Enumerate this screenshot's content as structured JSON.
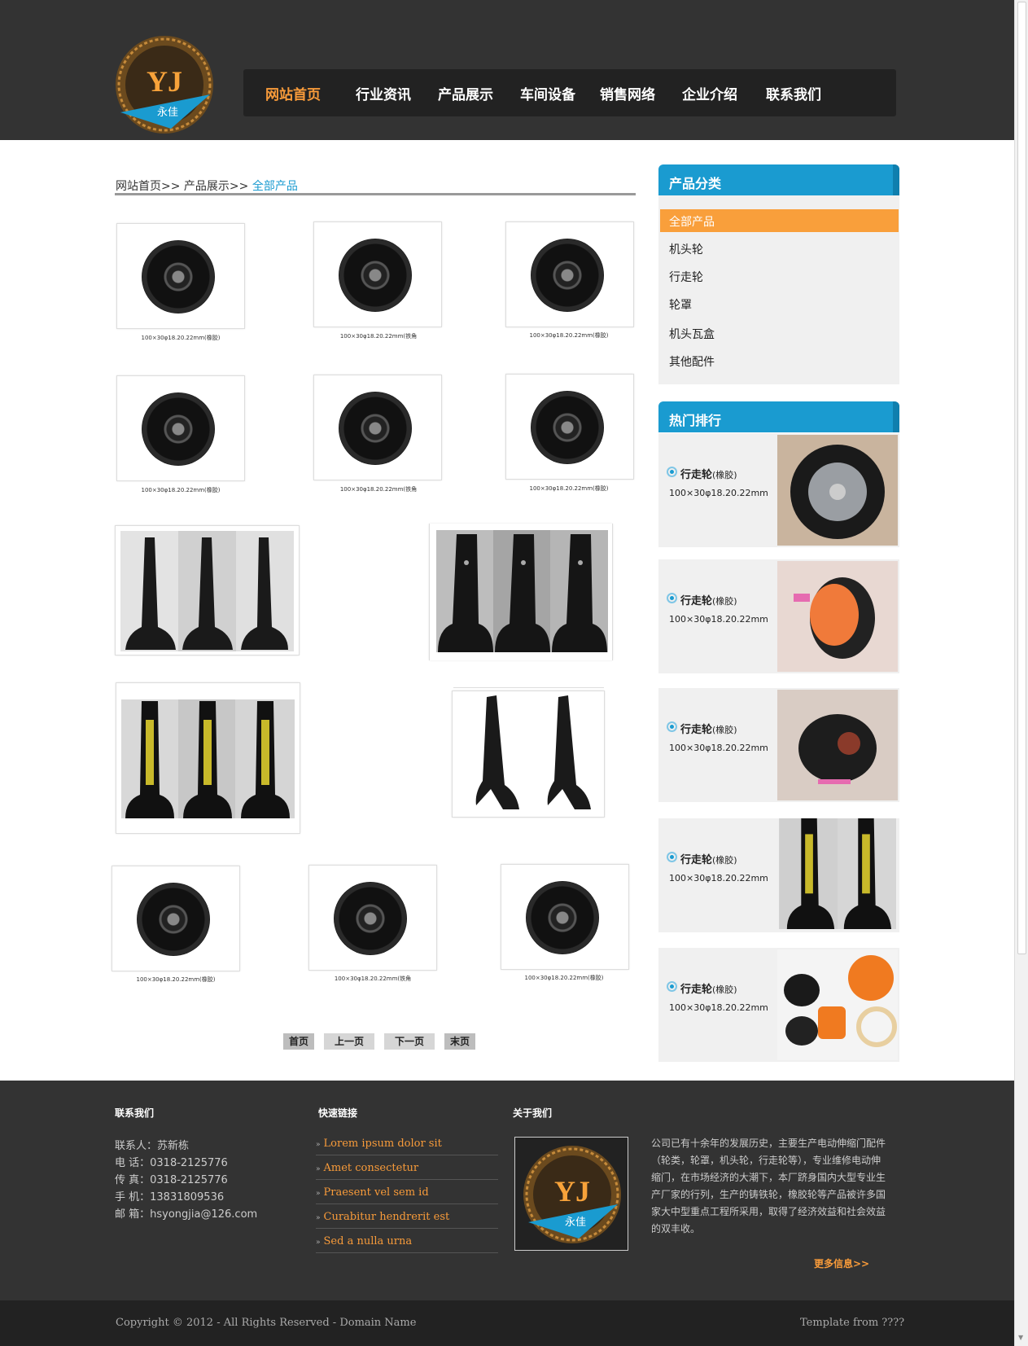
{
  "nav": {
    "items": [
      "网站首页",
      "行业资讯",
      "产品展示",
      "车间设备",
      "销售网络",
      "企业介绍",
      "联系我们"
    ]
  },
  "logo": {
    "letters": "YJ",
    "subtitle": "永佳"
  },
  "breadcrumb": {
    "home": "网站首页>>",
    "products": "产品展示>>",
    "current": "全部产品"
  },
  "products": [
    {
      "caption": "100×30φ18.20.22mm(橡胶)"
    },
    {
      "caption": "100×30φ18.20.22mm(铁角"
    },
    {
      "caption": "100×30φ18.20.22mm(橡胶)"
    },
    {
      "caption": "100×30φ18.20.22mm(橡胶)"
    },
    {
      "caption": "100×30φ18.20.22mm(铁角"
    },
    {
      "caption": "100×30φ18.20.22mm(橡胶)"
    },
    {
      "caption": "100×30φ18.20.22mm(橡胶)"
    },
    {
      "caption": "100×30φ18.20.22mm(铁角"
    },
    {
      "caption": "100×30φ18.20.22mm(橡胶)"
    }
  ],
  "pagination": {
    "first": "首页",
    "prev": "上一页",
    "next": "下一页",
    "last": "末页"
  },
  "sidebar": {
    "categories_title": "产品分类",
    "categories": [
      "全部产品",
      "机头轮",
      "行走轮",
      "轮罩",
      "机头瓦盒",
      "其他配件"
    ],
    "hot_title": "热门排行",
    "hot_items": [
      {
        "name": "行走轮",
        "tag": "(橡胶)",
        "size": "100×30φ18.20.22mm"
      },
      {
        "name": "行走轮",
        "tag": "(橡胶)",
        "size": "100×30φ18.20.22mm"
      },
      {
        "name": "行走轮",
        "tag": "(橡胶)",
        "size": "100×30φ18.20.22mm"
      },
      {
        "name": "行走轮",
        "tag": "(橡胶)",
        "size": "100×30φ18.20.22mm"
      },
      {
        "name": "行走轮",
        "tag": "(橡胶)",
        "size": "100×30φ18.20.22mm"
      }
    ]
  },
  "footer": {
    "contact_title": "联系我们",
    "contact": [
      "联系人：苏新栋",
      "电 话：0318-2125776",
      "传 真：0318-2125776",
      "手 机：13831809536",
      "邮 箱：hsyongjia@126.com"
    ],
    "links_title": "快速链接",
    "links": [
      "Lorem ipsum dolor sit",
      "Amet consectetur",
      "Praesent vel sem id",
      "Curabitur hendrerit est",
      "Sed a nulla urna"
    ],
    "about_title": "关于我们",
    "about_text": "公司已有十余年的发展历史，主要生产电动伸缩门配件（轮类，轮罩，机头轮，行走轮等），专业维修电动伸缩门，在市场经济的大潮下，本厂跻身国内大型专业生产厂家的行列，生产的铸铁轮，橡胶轮等产品被许多国家大中型重点工程所采用，取得了经济效益和社会效益的双丰收。",
    "more": "更多信息>>",
    "copyright": "Copyright © 2012 - All Rights Reserved - Domain Name",
    "template": "Template from ????"
  },
  "colors": {
    "accent_orange": "#f89b3a",
    "accent_blue": "#1a9bd0",
    "dark_bg": "#333333"
  }
}
